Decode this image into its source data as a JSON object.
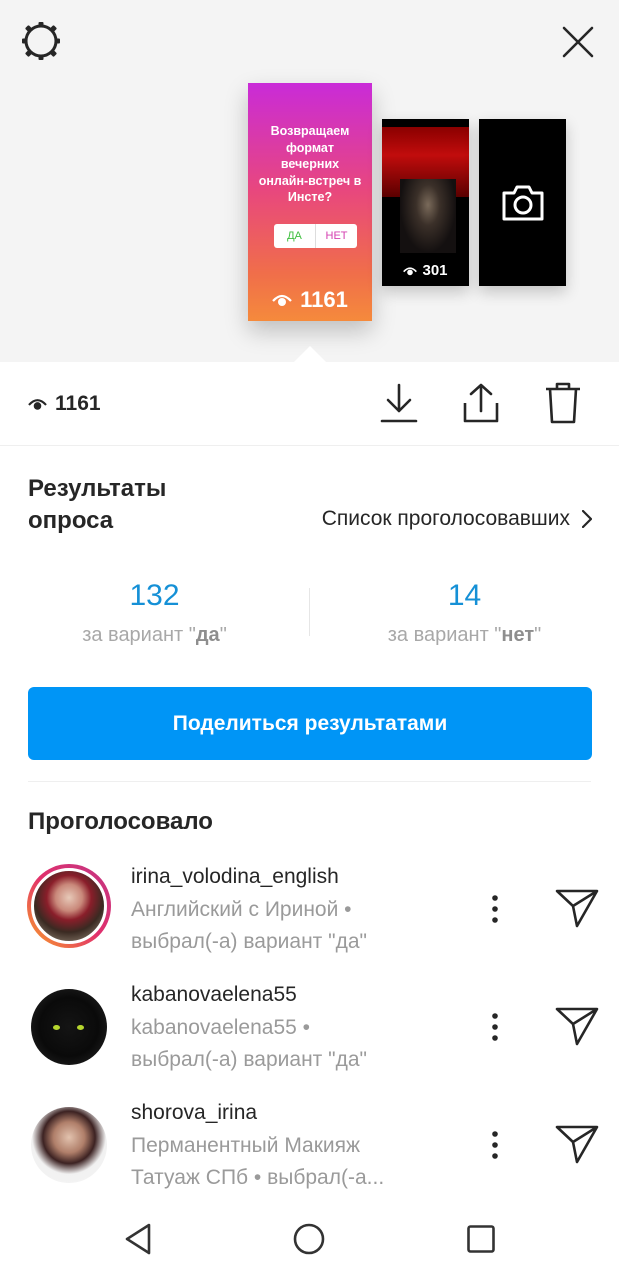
{
  "story_preview": {
    "story1": {
      "question": "Возвращаем формат вечерних онлайн-встреч в Инсте?",
      "poll_yes": "ДА",
      "poll_no": "НЕТ",
      "views": "1161"
    },
    "story2": {
      "views": "301"
    }
  },
  "toolbar": {
    "views": "1161"
  },
  "poll_results": {
    "title": "Результаты опроса",
    "voters_link": "Список проголосовавших",
    "yes_count": "132",
    "no_count": "14",
    "label_prefix": "за вариант ",
    "yes_option": "да",
    "no_option": "нет",
    "share_button": "Поделиться результатами"
  },
  "voted": {
    "title": "Проголосовало",
    "users": [
      {
        "username": "irina_volodina_english",
        "line1": "Английский с Ириной •",
        "line2": "выбрал(-а) вариант \"да\""
      },
      {
        "username": "kabanovaelena55",
        "line1": "kabanovaelena55 •",
        "line2": "выбрал(-а) вариант \"да\""
      },
      {
        "username": "shorova_irina",
        "line1": "Перманентный Макияж",
        "line2": "Татуаж СПб • выбрал(-а..."
      }
    ]
  },
  "icons": {
    "settings": "gear-icon",
    "close": "close-icon",
    "download": "download-icon",
    "share": "share-icon",
    "delete": "trash-icon",
    "eye": "eye-icon",
    "camera": "camera-icon",
    "more": "more-vertical-icon",
    "send": "send-icon"
  },
  "colors": {
    "accent": "#0095f6",
    "count": "#1590d6"
  }
}
